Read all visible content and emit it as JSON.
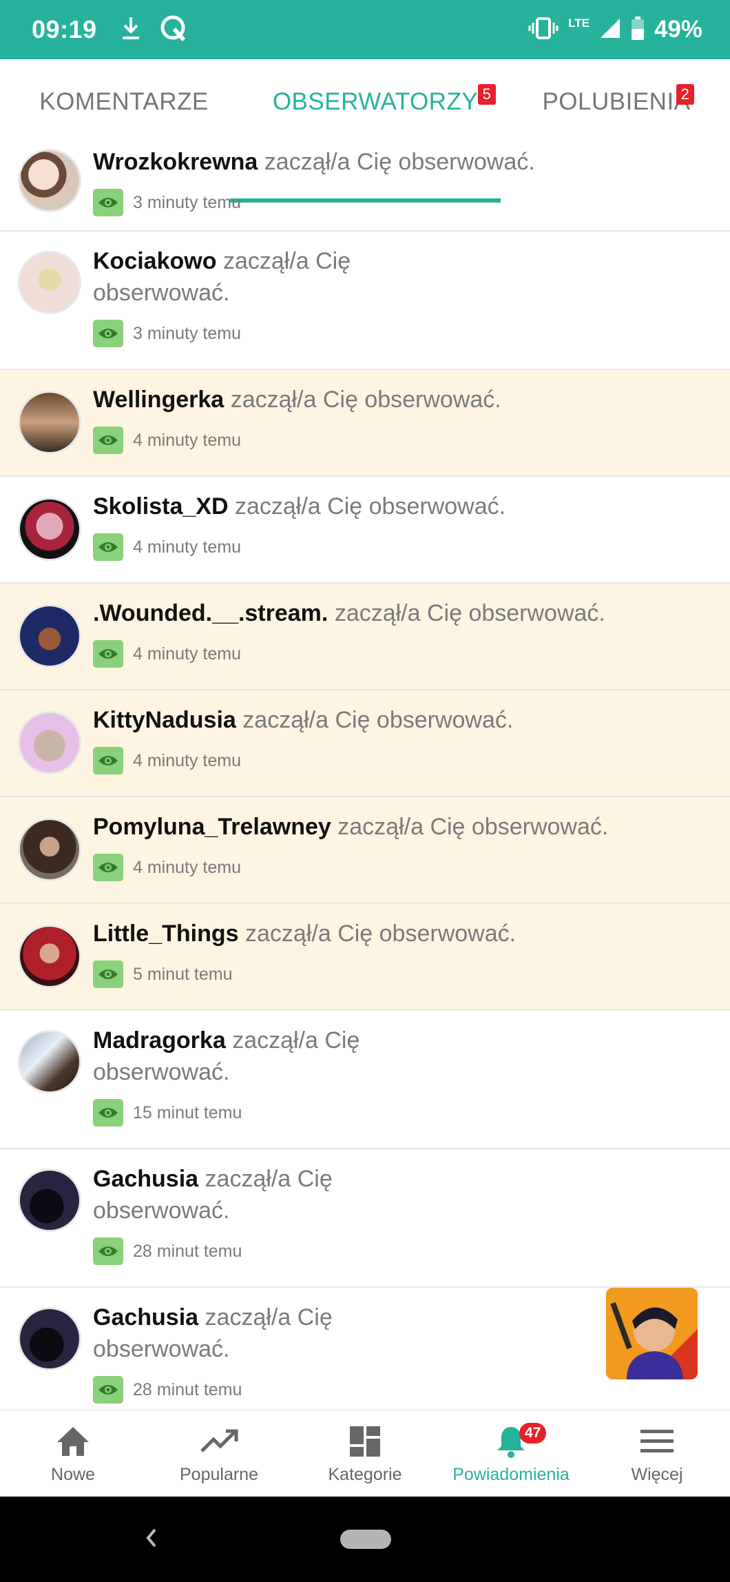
{
  "status_bar": {
    "time": "09:19",
    "lte": "LTE",
    "battery": "49%"
  },
  "tabs": [
    {
      "label": "KOMENTARZE",
      "badge": ""
    },
    {
      "label": "OBSERWATORZY",
      "badge": "5"
    },
    {
      "label": "POLUBIENIA",
      "badge": "2"
    }
  ],
  "action_text": "zaczął/a Cię obserwować.",
  "notifications": [
    {
      "user": "Wrozkokrewna",
      "time": "3 minuty temu"
    },
    {
      "user": "Kociakowo",
      "time": "3 minuty temu"
    },
    {
      "user": "Wellingerka",
      "time": "4 minuty temu"
    },
    {
      "user": "Skolista_XD",
      "time": "4 minuty temu"
    },
    {
      "user": ".Wounded.__.stream.",
      "time": "4 minuty temu"
    },
    {
      "user": "KittyNadusia",
      "time": "4 minuty temu"
    },
    {
      "user": "Pomyluna_Trelawney",
      "time": "4 minuty temu"
    },
    {
      "user": "Little_Things",
      "time": "5 minut temu"
    },
    {
      "user": "Madragorka",
      "time": "15 minut temu"
    },
    {
      "user": "Gachusia",
      "time": "28 minut temu"
    },
    {
      "user": "Gachusia",
      "time": "28 minut temu"
    }
  ],
  "bottom_nav": [
    {
      "label": "Nowe",
      "icon": "home-icon"
    },
    {
      "label": "Popularne",
      "icon": "trending-icon"
    },
    {
      "label": "Kategorie",
      "icon": "dashboard-icon"
    },
    {
      "label": "Powiadomienia",
      "icon": "bell-icon",
      "badge": "47"
    },
    {
      "label": "Więcej",
      "icon": "menu-icon"
    }
  ],
  "colors": {
    "accent": "#26b29b",
    "unread_bg": "#fdf4e1",
    "badge": "#e8202b",
    "eye": "#8bd07a"
  }
}
